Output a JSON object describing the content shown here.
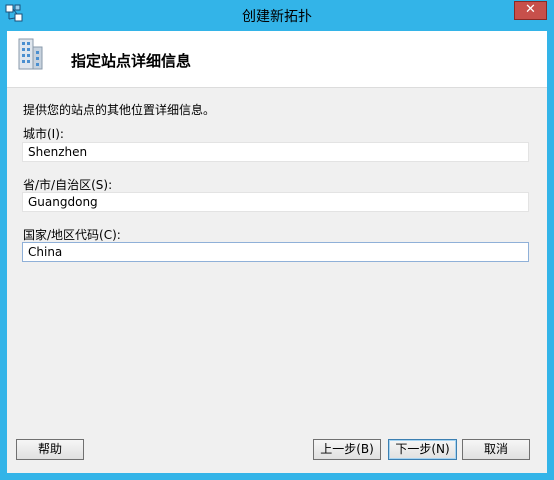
{
  "window": {
    "title": "创建新拓扑",
    "close_label": "✕"
  },
  "header": {
    "title": "指定站点详细信息"
  },
  "description": "提供您的站点的其他位置详细信息。",
  "fields": {
    "city": {
      "label": "城市(I):",
      "value": "Shenzhen"
    },
    "province": {
      "label": "省/市/自治区(S):",
      "value": "Guangdong"
    },
    "country": {
      "label": "国家/地区代码(C):",
      "value": "China"
    }
  },
  "buttons": {
    "help": "帮助",
    "back": "上一步(B)",
    "next": "下一步(N)",
    "cancel": "取消"
  },
  "icons": {
    "app": "topology-icon",
    "header": "building-icon"
  }
}
